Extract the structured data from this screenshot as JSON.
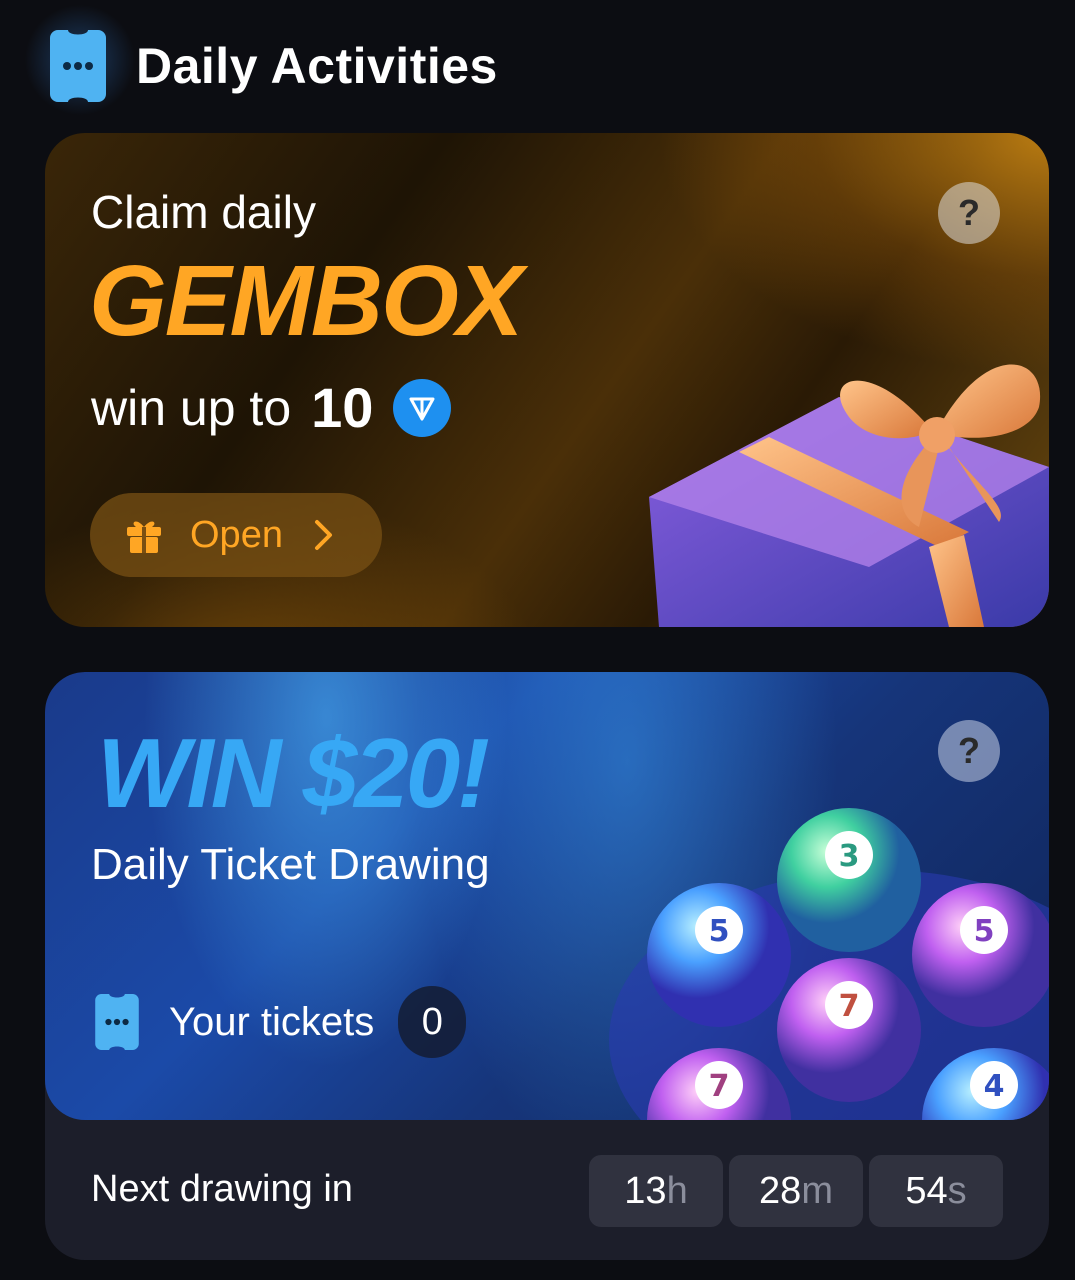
{
  "header": {
    "title": "Daily Activities"
  },
  "gembox": {
    "line1": "Claim daily",
    "title": "GEMBOX",
    "win_prefix": "win up to",
    "amount": "10",
    "currency_icon": "ton-icon",
    "help": "?",
    "open_label": "Open",
    "colors": {
      "accent": "#ffa624"
    }
  },
  "drawing": {
    "title": "WIN $20!",
    "subtitle": "Daily Ticket Drawing",
    "help": "?",
    "tickets_label": "Your tickets",
    "tickets_count": "0",
    "next_label": "Next drawing in",
    "timer": {
      "hours": "13",
      "hours_unit": "h",
      "minutes": "28",
      "minutes_unit": "m",
      "seconds": "54",
      "seconds_unit": "s"
    },
    "ball_numbers": [
      "3",
      "5",
      "5",
      "7",
      "7",
      "4"
    ],
    "colors": {
      "accent": "#37a8f5"
    }
  }
}
